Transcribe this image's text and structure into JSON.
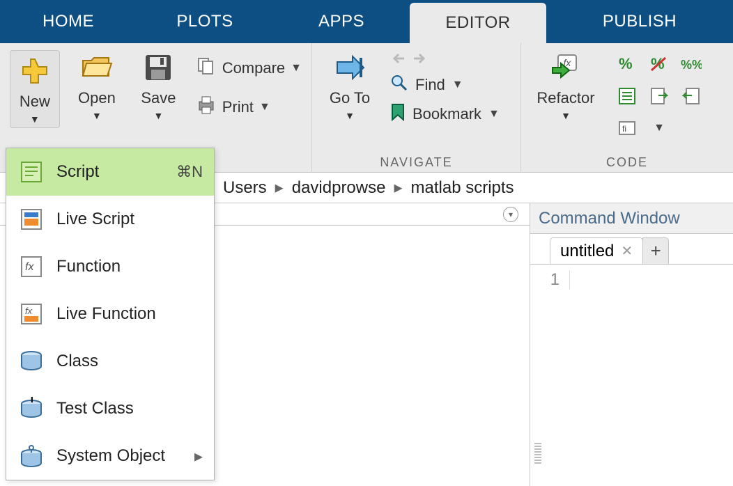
{
  "tabs": {
    "home": "HOME",
    "plots": "PLOTS",
    "apps": "APPS",
    "editor": "EDITOR",
    "publish": "PUBLISH"
  },
  "ribbon": {
    "new": "New",
    "open": "Open",
    "save": "Save",
    "compare": "Compare",
    "print": "Print",
    "goto": "Go To",
    "find": "Find",
    "bookmark": "Bookmark",
    "navigate_group": "NAVIGATE",
    "refactor": "Refactor",
    "code_group": "CODE"
  },
  "breadcrumb": {
    "p1": "Users",
    "p2": "davidprowse",
    "p3": "matlab scripts"
  },
  "newMenu": {
    "script": "Script",
    "script_shortcut": "⌘N",
    "live_script": "Live Script",
    "function": "Function",
    "live_function": "Live Function",
    "class": "Class",
    "test_class": "Test Class",
    "system_object": "System Object"
  },
  "command": {
    "title": "Command Window"
  },
  "editor": {
    "tab_name": "untitled",
    "line1": "1"
  }
}
